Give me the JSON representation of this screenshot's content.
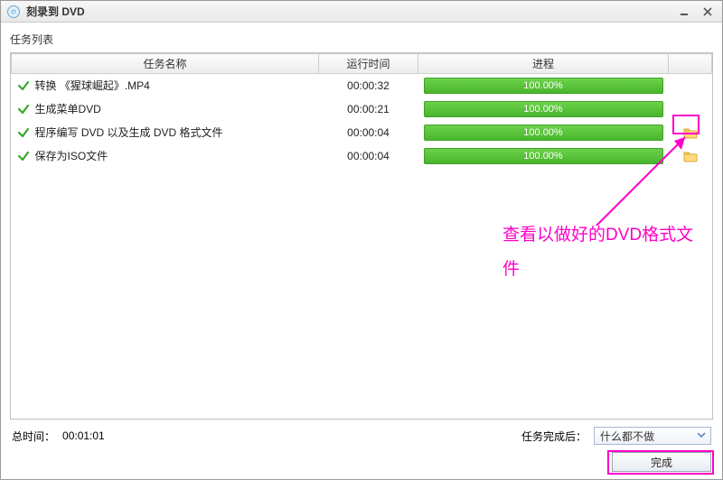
{
  "window": {
    "title": "刻录到 DVD"
  },
  "labels": {
    "task_list": "任务列表",
    "total_time_label": "总时间：",
    "total_time_value": "00:01:01",
    "after_done_label": "任务完成后：",
    "after_done_value": "什么都不做",
    "complete_button": "完成"
  },
  "columns": {
    "name": "任务名称",
    "runtime": "运行时间",
    "progress": "进程",
    "action": ""
  },
  "tasks": [
    {
      "name": "转换 《猩球崛起》.MP4",
      "time": "00:00:32",
      "progress": "100.00%",
      "has_folder": false
    },
    {
      "name": "生成菜单DVD",
      "time": "00:00:21",
      "progress": "100.00%",
      "has_folder": false
    },
    {
      "name": "程序编写 DVD 以及生成 DVD 格式文件",
      "time": "00:00:04",
      "progress": "100.00%",
      "has_folder": true
    },
    {
      "name": "保存为ISO文件",
      "time": "00:00:04",
      "progress": "100.00%",
      "has_folder": true
    }
  ],
  "annotation": {
    "text": "查看以做好的DVD格式文件"
  }
}
